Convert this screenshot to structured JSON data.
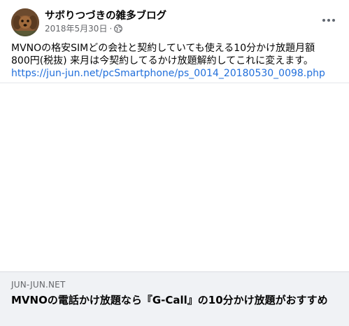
{
  "post": {
    "author": "サボりつづきの雑多ブログ",
    "date": "2018年5月30日",
    "separator": "·",
    "visibility_icon": "globe-icon",
    "more_icon": "more-options-icon",
    "message_line1": "MVNOの格安SIMどの会社と契約していても使える10分かけ放題月額",
    "message_line2": "800円(税抜) 来月は今契約してるかけ放題解約してこれに変えます。",
    "link_url": "https://jun-jun.net/pcSmartphone/ps_0014_20180530_0098.php"
  },
  "link_card": {
    "domain": "JUN-JUN.NET",
    "title": "MVNOの電話かけ放題なら『G-Call』の10分かけ放題がおすすめ"
  },
  "colors": {
    "link": "#216fdb",
    "secondary_text": "#65676b",
    "card_background": "#f0f2f5"
  }
}
